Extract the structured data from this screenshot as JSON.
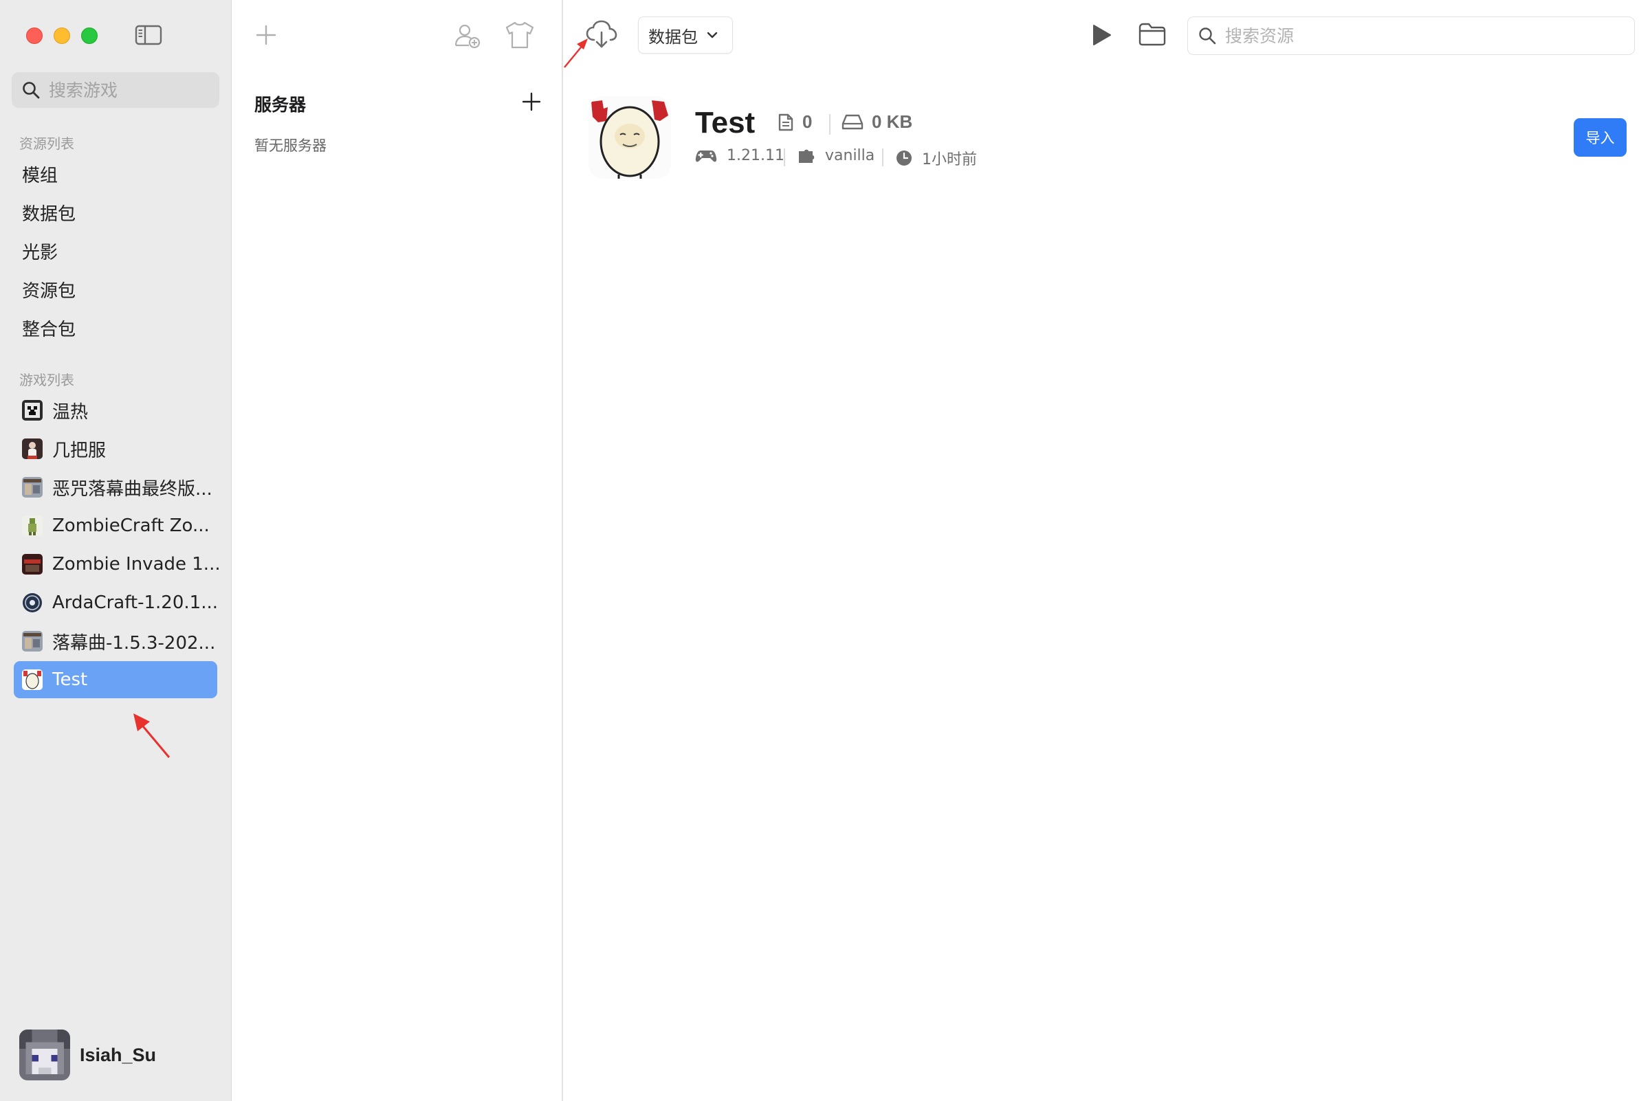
{
  "window": {
    "traffic_lights": [
      "close",
      "minimize",
      "zoom"
    ]
  },
  "sidebar": {
    "search_placeholder": "搜索游戏",
    "resources_section": "资源列表",
    "resource_items": [
      {
        "label": "模组"
      },
      {
        "label": "数据包"
      },
      {
        "label": "光影"
      },
      {
        "label": "资源包"
      },
      {
        "label": "整合包"
      }
    ],
    "games_section": "游戏列表",
    "game_items": [
      {
        "label": "温热",
        "icon": "game-icon-creeper"
      },
      {
        "label": "几把服",
        "icon": "game-icon-figure"
      },
      {
        "label": "恶咒落幕曲最终版...",
        "icon": "game-icon-modpack"
      },
      {
        "label": "ZombieCraft Zo...",
        "icon": "game-icon-zombie"
      },
      {
        "label": "Zombie Invade 1...",
        "icon": "game-icon-invade"
      },
      {
        "label": "ArdaCraft-1.20.1...",
        "icon": "game-icon-arda"
      },
      {
        "label": "落幕曲-1.5.3-202...",
        "icon": "game-icon-modpack"
      },
      {
        "label": "Test",
        "icon": "game-icon-egg",
        "selected": true
      }
    ],
    "user": {
      "name": "Isiah_Su"
    }
  },
  "middle": {
    "servers_title": "服务器",
    "empty_text": "暂无服务器"
  },
  "toolbar": {
    "resource_type": "数据包",
    "search_placeholder": "搜索资源"
  },
  "game": {
    "title": "Test",
    "file_count": "0",
    "size": "0 KB",
    "version": "1.21.11",
    "loader": "vanilla",
    "last_played": "1小时前",
    "import_label": "导入"
  },
  "colors": {
    "accent": "#2f7cf6",
    "selection": "#6aa3f5",
    "annotation_arrow": "#e8322d"
  }
}
